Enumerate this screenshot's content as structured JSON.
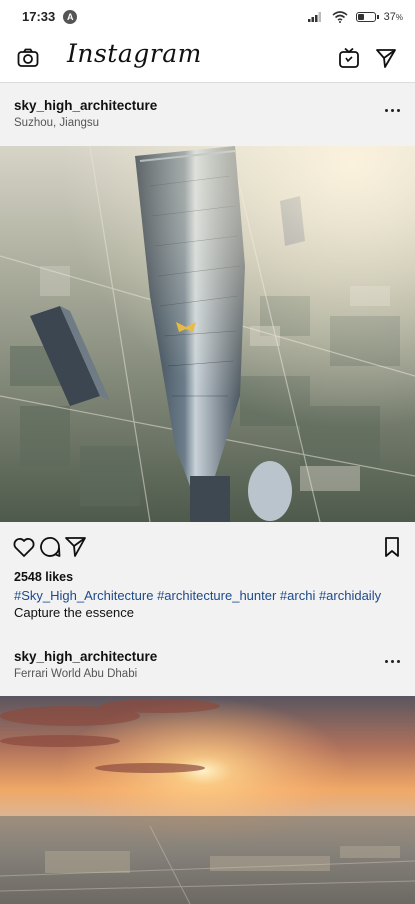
{
  "status_bar": {
    "time": "17:33",
    "notification_letter": "A",
    "battery_percent": "37",
    "battery_unit": "%",
    "battery_level": 0.37
  },
  "top_bar": {
    "camera_icon": "camera-icon",
    "logo": "Instagram",
    "igtv_icon": "igtv-icon",
    "direct_icon": "paper-plane-icon"
  },
  "posts": [
    {
      "username": "sky_high_architecture",
      "location": "Suzhou, Jiangsu",
      "likes": "2548 likes",
      "hashtags": "#Sky_High_Architecture #architecture_hunter #archi #archidaily",
      "caption": "Capture the essence"
    },
    {
      "username": "sky_high_architecture",
      "location": "Ferrari World Abu Dhabi"
    }
  ],
  "colors": {
    "hashtag": "#1e4a8a",
    "background": "#f2f2f2"
  }
}
